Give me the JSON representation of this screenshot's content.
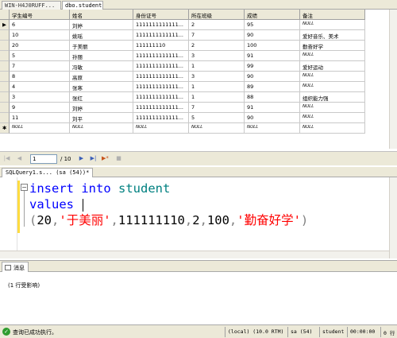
{
  "tabs": [
    "WIN-H4J0RUFF...",
    "dbo.student"
  ],
  "grid": {
    "columns": [
      "学生编号",
      "姓名",
      "身份证号",
      "所在班级",
      "成绩",
      "备注"
    ],
    "rows": [
      [
        "6",
        "刘婷",
        "1111111111111...",
        "2",
        "95",
        "NULL"
      ],
      [
        "10",
        "姚瑶",
        "1111111111111...",
        "7",
        "90",
        "爱好音乐、美术"
      ],
      [
        "20",
        "于美丽",
        "111111110",
        "2",
        "100",
        "勤奋好学"
      ],
      [
        "5",
        "孙丽",
        "1111111111111...",
        "3",
        "91",
        "NULL"
      ],
      [
        "7",
        "冯敏",
        "1111111111111...",
        "1",
        "99",
        "爱好运动"
      ],
      [
        "8",
        "高原",
        "1111111111111...",
        "3",
        "90",
        "NULL"
      ],
      [
        "4",
        "张寒",
        "1111111111111...",
        "1",
        "89",
        "NULL"
      ],
      [
        "3",
        "张红",
        "1111111111111...",
        "1",
        "88",
        "组织能力强"
      ],
      [
        "9",
        "刘婷",
        "1111111111111...",
        "7",
        "91",
        "NULL"
      ],
      [
        "11",
        "刘平",
        "1111111111111...",
        "5",
        "90",
        "NULL"
      ],
      [
        "NULL",
        "NULL",
        "NULL",
        "NULL",
        "NULL",
        "NULL"
      ]
    ],
    "current_marker": "▶",
    "new_marker": "✱"
  },
  "nav": {
    "page": "1",
    "total": "/ 10"
  },
  "query_tab": "SQLQuery1.s... (sa (54))*",
  "code": {
    "line1_kw1": "insert",
    "line1_kw2": "into",
    "line1_obj": "student",
    "line2_kw": "values",
    "line3_open": "(",
    "line3_n1": "20",
    "line3_c1": ",",
    "line3_s1": "'于美丽'",
    "line3_c2": ",",
    "line3_n2": "111111110",
    "line3_c3": ",",
    "line3_n3": "2",
    "line3_c4": ",",
    "line3_n4": "100",
    "line3_c5": ",",
    "line3_s2": "'勤奋好学'",
    "line3_close": ")"
  },
  "messages": {
    "tab_label": "消息",
    "text": "(1 行受影响)"
  },
  "status": {
    "main": "查询已成功执行。",
    "server": "(local) (10.0 RTM)",
    "user": "sa (54)",
    "db": "student",
    "time": "00:00:00",
    "rows": "0 行"
  },
  "colors": {
    "keyword": "#0000ff",
    "object": "#008080",
    "string": "#ff0000",
    "status_ok": "#2e9c2e"
  }
}
